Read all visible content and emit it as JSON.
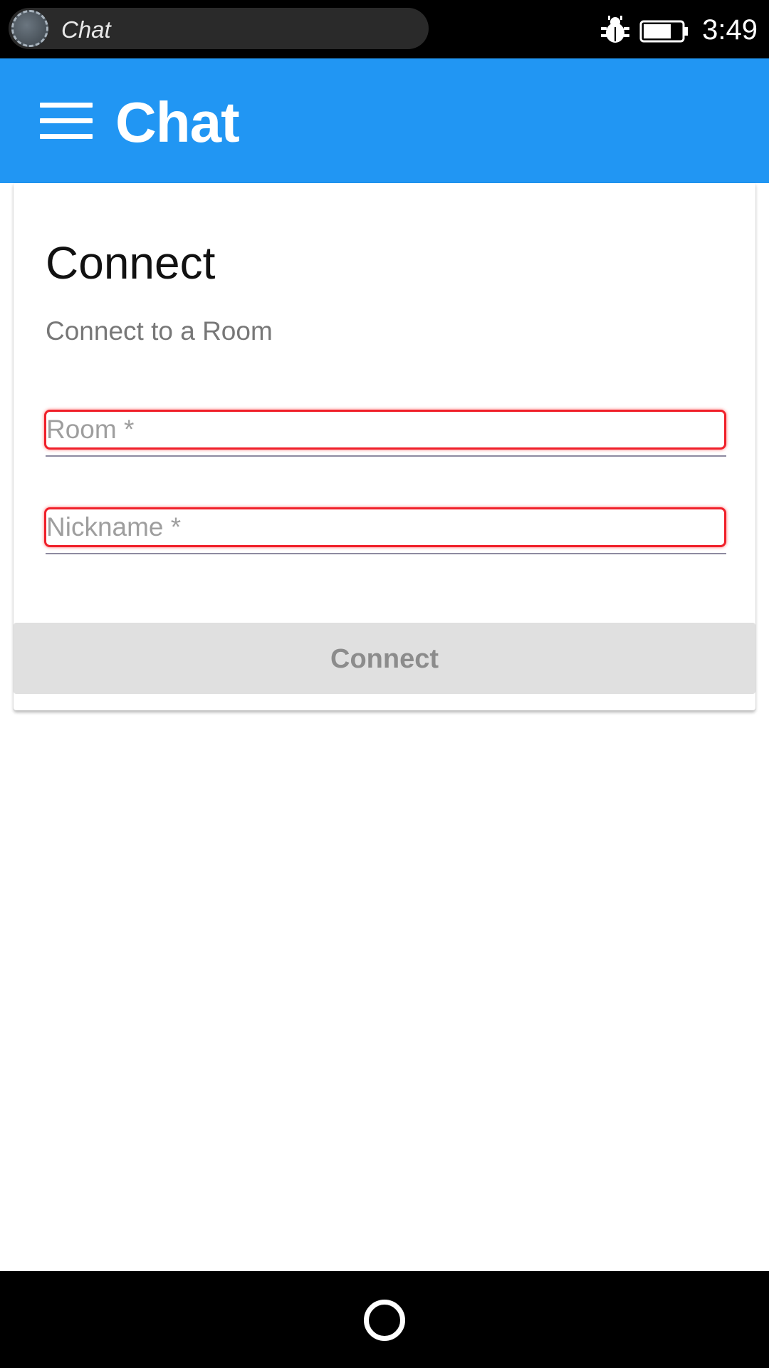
{
  "status_bar": {
    "app_label": "Chat",
    "time": "3:49",
    "icons": [
      "bug-icon",
      "battery-icon"
    ]
  },
  "app_bar": {
    "title": "Chat",
    "menu_icon": "hamburger-menu-icon",
    "color": "#2196f3"
  },
  "connect_card": {
    "title": "Connect",
    "subtitle": "Connect to a Room",
    "room_field": {
      "placeholder": "Room *",
      "value": ""
    },
    "nickname_field": {
      "placeholder": "Nickname *",
      "value": ""
    },
    "connect_button_label": "Connect",
    "invalid_color": "#f0202a"
  },
  "nav_bar": {
    "home_icon": "home-circle-icon"
  }
}
